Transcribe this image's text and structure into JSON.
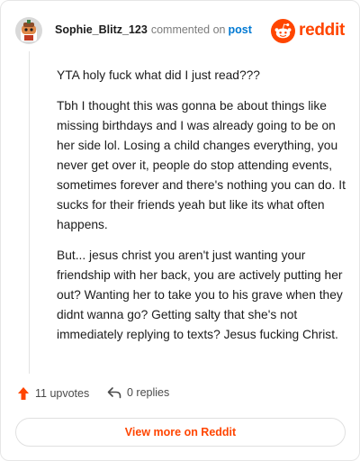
{
  "header": {
    "username": "Sophie_Blitz_123",
    "action": "commented on",
    "post_link": "post",
    "brand_wordmark": "reddit",
    "brand_color": "#ff4500",
    "link_color": "#0079d3"
  },
  "comment": {
    "paragraphs": [
      "YTA holy fuck what did I just read???",
      "Tbh I thought this was gonna be about things like missing birthdays and I was already going to be on her side lol. Losing a child changes everything, you never get over it, people do stop attending events, sometimes forever and there's nothing you can do. It sucks for their friends yeah but like its what often happens.",
      "But... jesus christ you aren't just wanting your friendship with her back, you are actively putting her out? Wanting her to take you to his grave when they didnt wanna go? Getting salty that she's not immediately replying to texts? Jesus fucking Christ."
    ]
  },
  "footer": {
    "upvotes": "11 upvotes",
    "replies": "0 replies",
    "upvote_icon": "arrow-up-icon",
    "reply_icon": "reply-arrow-icon"
  },
  "view_button": {
    "label": "View more on Reddit"
  }
}
